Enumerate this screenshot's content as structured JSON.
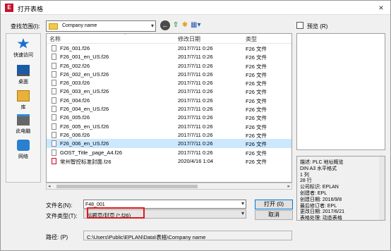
{
  "window": {
    "title": "打开表格",
    "app_icon": "eplan-logo-icon",
    "close_glyph": "×"
  },
  "toolbar": {
    "lookin_label": "查找范围(I):",
    "lookin_value": "Company name",
    "preview_label": "预览 (R)"
  },
  "places": [
    {
      "label": "快速访问",
      "icon": "quick-access-star-icon"
    },
    {
      "label": "桌面",
      "icon": "desktop-icon"
    },
    {
      "label": "库",
      "icon": "library-icon"
    },
    {
      "label": "此电脑",
      "icon": "this-pc-icon"
    },
    {
      "label": "网络",
      "icon": "network-icon"
    }
  ],
  "columns": {
    "name": "名称",
    "date": "修改日期",
    "type": "类型"
  },
  "files": [
    {
      "name": "F26_001.f26",
      "date": "2017/7/11 0:26",
      "type": "F26 文件"
    },
    {
      "name": "F26_001_en_US.f26",
      "date": "2017/7/11 0:26",
      "type": "F26 文件"
    },
    {
      "name": "F26_002.f26",
      "date": "2017/7/11 0:26",
      "type": "F26 文件"
    },
    {
      "name": "F26_002_en_US.f26",
      "date": "2017/7/11 0:26",
      "type": "F26 文件"
    },
    {
      "name": "F26_003.f26",
      "date": "2017/7/11 0:26",
      "type": "F26 文件"
    },
    {
      "name": "F26_003_en_US.f26",
      "date": "2017/7/11 0:26",
      "type": "F26 文件"
    },
    {
      "name": "F26_004.f26",
      "date": "2017/7/11 0:26",
      "type": "F26 文件"
    },
    {
      "name": "F26_004_en_US.f26",
      "date": "2017/7/11 0:26",
      "type": "F26 文件"
    },
    {
      "name": "F26_005.f26",
      "date": "2017/7/11 0:26",
      "type": "F26 文件"
    },
    {
      "name": "F26_005_en_US.f26",
      "date": "2017/7/11 0:26",
      "type": "F26 文件"
    },
    {
      "name": "F26_006.f26",
      "date": "2017/7/11 0:26",
      "type": "F26 文件"
    },
    {
      "name": "F26_006_en_US.f26",
      "date": "2017/7/11 0:26",
      "type": "F26 文件"
    },
    {
      "name": "GOST_Title _page_A4.f26",
      "date": "2017/7/11 0:26",
      "type": "F26 文件"
    },
    {
      "name": "常州智控标准封面.f26",
      "date": "2020/4/16 1:04",
      "type": "F26 文件"
    }
  ],
  "selected_index": 11,
  "info": [
    "描述: PLC 地址概览",
    "DIN A3 水平格式",
    "1 列",
    "28 行",
    "公司标识: EPLAN",
    "创建者: EPL",
    "创建日期: 2016/9/8",
    "最后修订者: EPL",
    "更改日期: 2017/6/21",
    "表格处理: 动态表格"
  ],
  "form": {
    "filename_label": "文件名(N):",
    "filename_value": "F48_001",
    "filetype_label": "文件类型(T):",
    "filetype_value": "标题页/封页 (*.f26)",
    "path_label": "路径: (P)",
    "path_value": "C:\\Users\\Public\\EPLAN\\Data\\表格\\Company name"
  },
  "buttons": {
    "open": "打开 (0)",
    "cancel": "取消"
  },
  "colors": {
    "selection": "#cce8ff",
    "highlight_box": "#e01818",
    "accent": "#0078d7"
  }
}
